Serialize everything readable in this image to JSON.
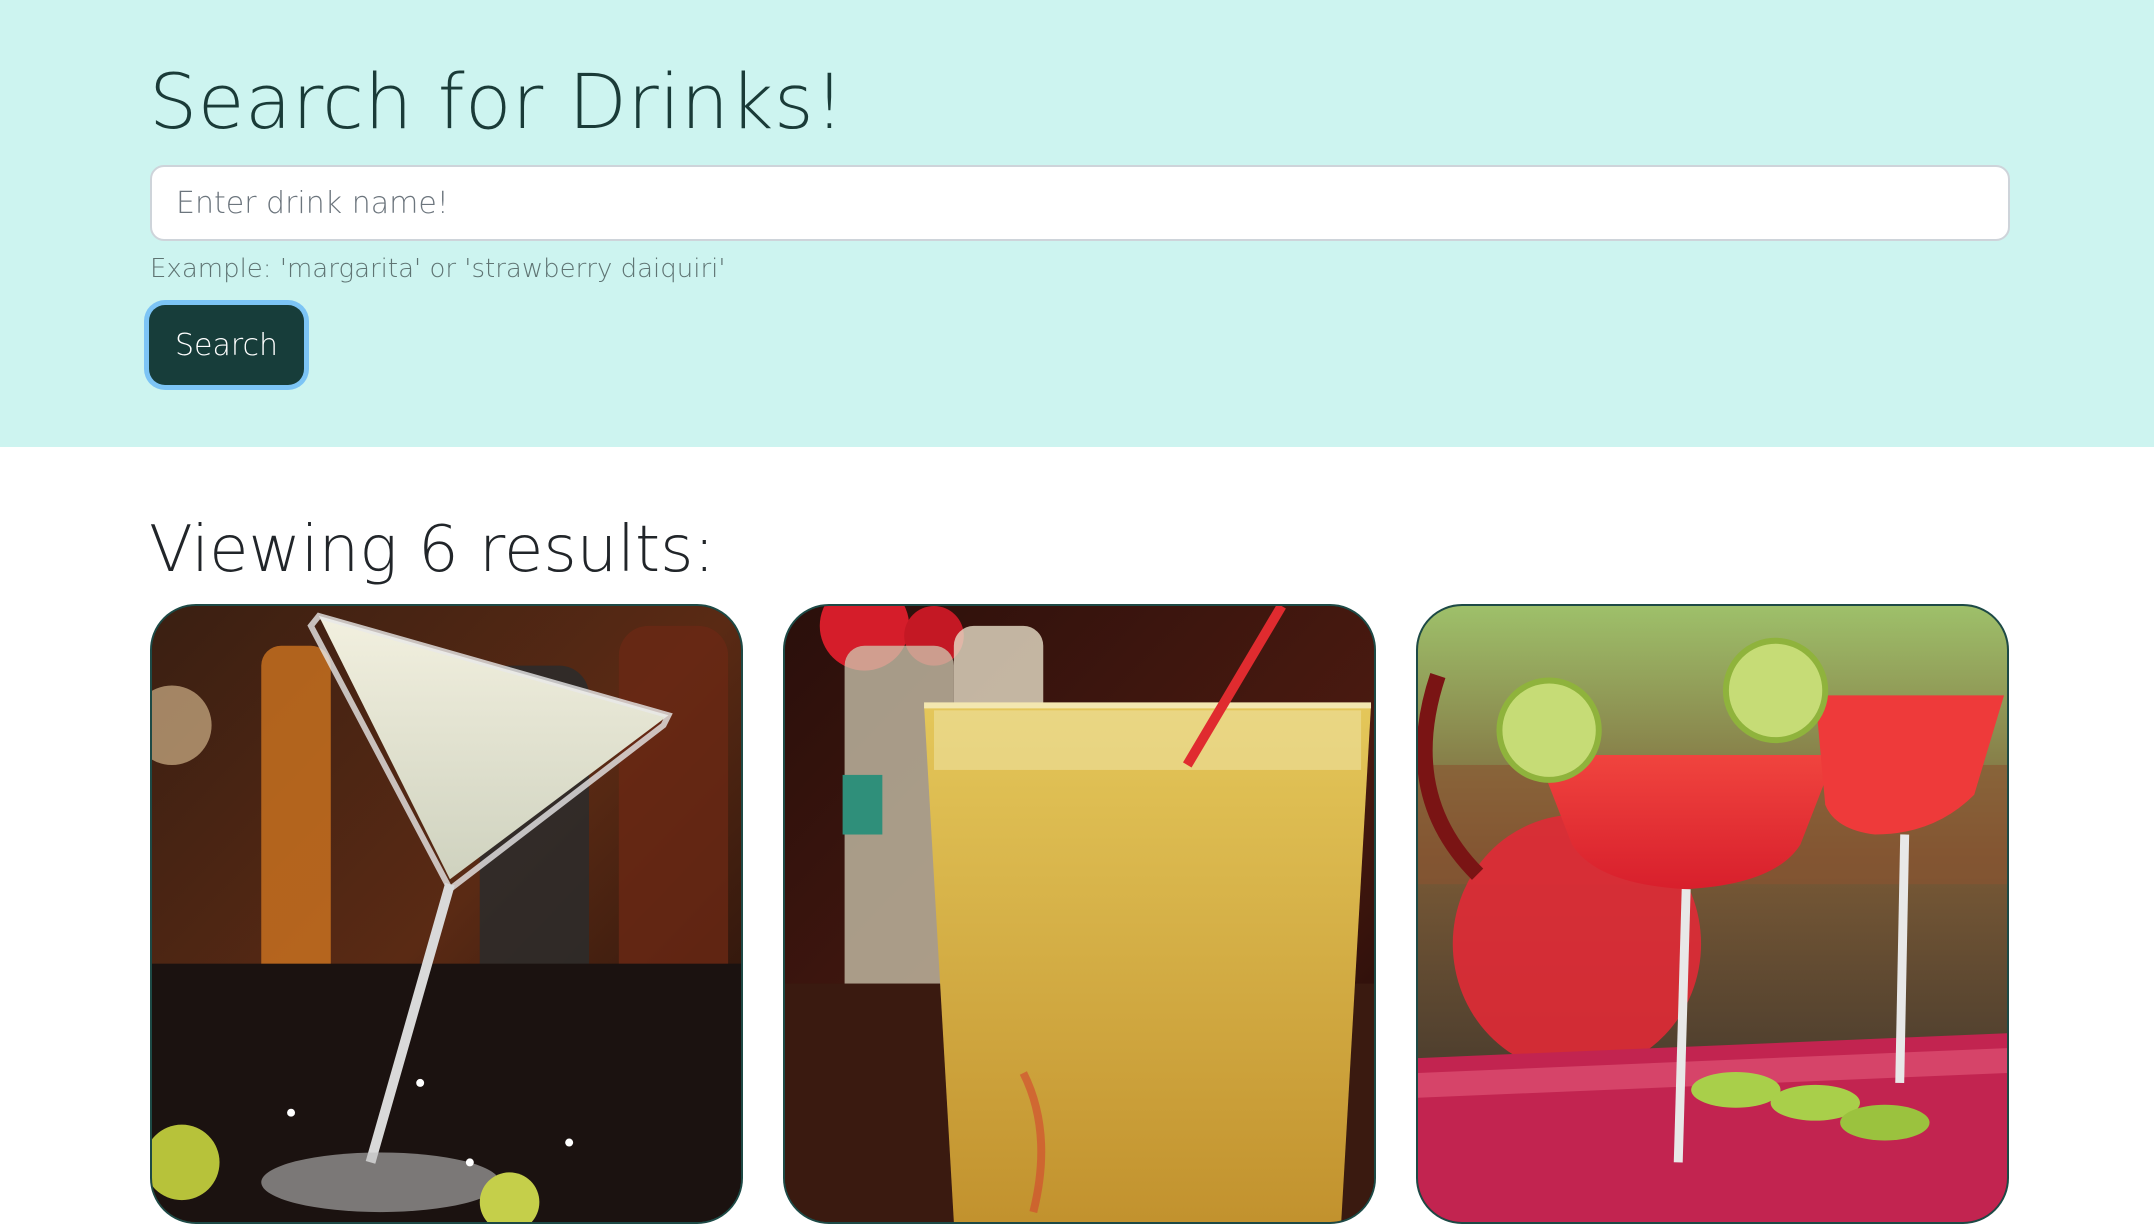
{
  "header": {
    "title": "Search for Drinks!",
    "search_placeholder": "Enter drink name!",
    "help_text": "Example: 'margarita' or 'strawberry daiquiri'",
    "search_button_label": "Search"
  },
  "results": {
    "heading": "Viewing 6 results:",
    "cards": [
      {
        "image": "martini-glass-drink-photo"
      },
      {
        "image": "iced-yellow-drink-with-red-straw-photo"
      },
      {
        "image": "red-margaritas-with-lime-and-pitcher-photo"
      }
    ]
  },
  "colors": {
    "hero_background": "#cdf4f0",
    "primary": "#173d3a",
    "focus_ring": "#7cc4f5"
  }
}
